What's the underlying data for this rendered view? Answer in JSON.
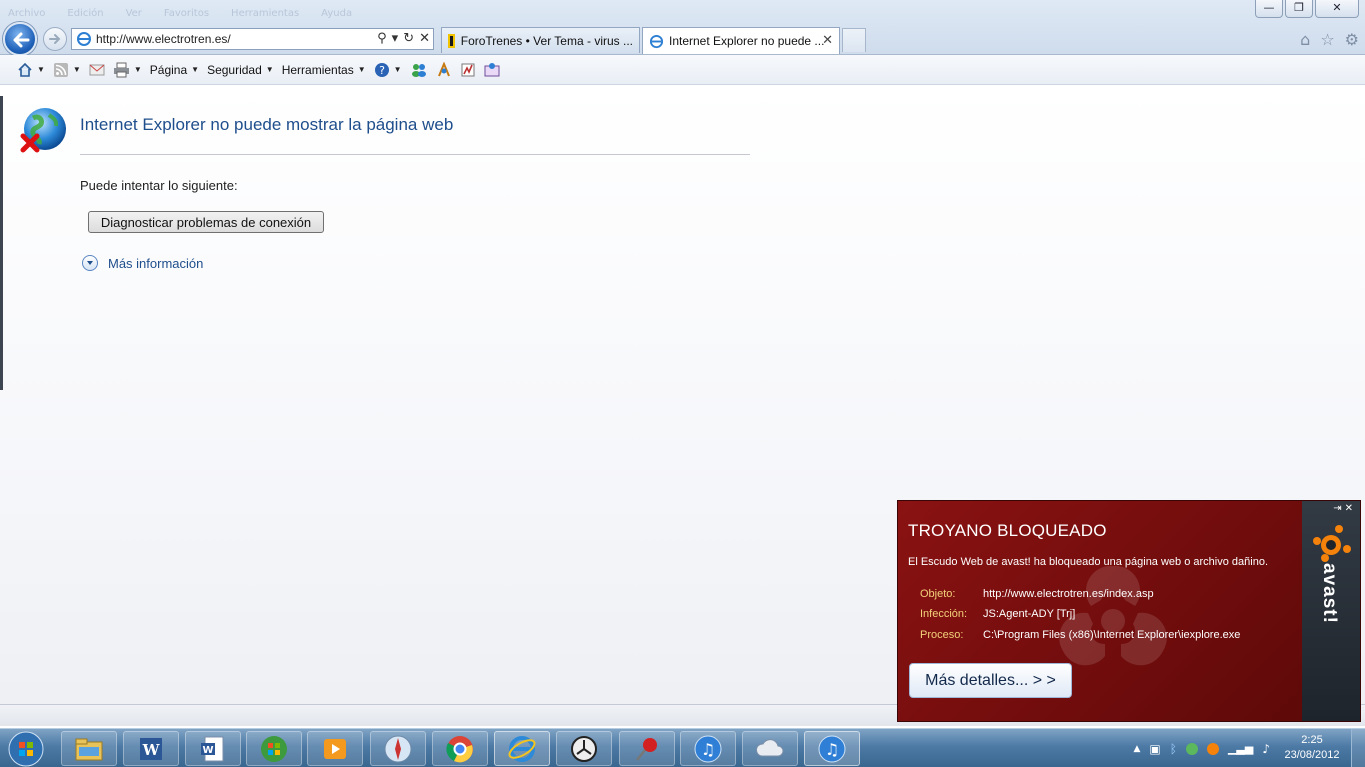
{
  "browser": {
    "address": "http://www.electrotren.es/",
    "tabs": [
      {
        "label": "ForoTrenes • Ver Tema - virus ...",
        "active": false
      },
      {
        "label": "Internet Explorer no puede ...",
        "active": true
      }
    ],
    "window_buttons": [
      "—",
      "❐",
      "✕"
    ]
  },
  "command_bar": {
    "pagina": "Página",
    "seguridad": "Seguridad",
    "herramientas": "Herramientas"
  },
  "error_page": {
    "title": "Internet Explorer no puede mostrar la página web",
    "try_text": "Puede intentar lo siguiente:",
    "diagnose_button": "Diagnosticar problemas de conexión",
    "more_info": "Más información"
  },
  "avast": {
    "title": "TROYANO BLOQUEADO",
    "message": "El Escudo Web de avast! ha bloqueado una página web o archivo dañino.",
    "details": [
      {
        "key": "Objeto:",
        "value": "http://www.electrotren.es/index.asp"
      },
      {
        "key": "Infección:",
        "value": "JS:Agent-ADY [Trj]"
      },
      {
        "key": "Proceso:",
        "value": "C:\\Program Files (x86)\\Internet Explorer\\iexplore.exe"
      }
    ],
    "button": "Más detalles... > >",
    "brand": "avast!",
    "colors": {
      "background": "#7a0f0f",
      "key_text": "#f3d27a",
      "side": "#2a3038"
    }
  },
  "taskbar": {
    "apps": [
      "windows-explorer-icon",
      "word-icon",
      "word-doc-icon",
      "windows-media-center-icon",
      "media-player-icon",
      "safari-icon",
      "chrome-icon",
      "internet-explorer-icon",
      "clock-app-icon",
      "pin-icon",
      "itunes-icon",
      "icloud-icon",
      "itunes-active-icon"
    ],
    "time": "2:25",
    "date": "23/08/2012"
  }
}
